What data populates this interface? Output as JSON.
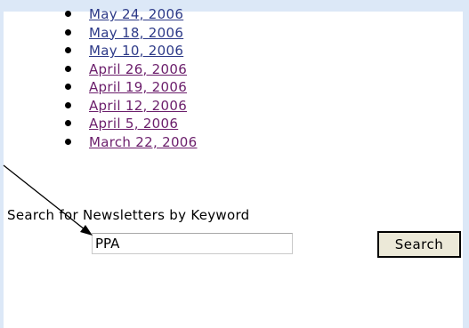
{
  "newsletter_dates": [
    {
      "label": "May 24, 2006",
      "visited": false
    },
    {
      "label": "May 18, 2006",
      "visited": false
    },
    {
      "label": "May 10, 2006",
      "visited": false
    },
    {
      "label": "April 26, 2006",
      "visited": true
    },
    {
      "label": "April 19, 2006",
      "visited": true
    },
    {
      "label": "April 12, 2006",
      "visited": true
    },
    {
      "label": "April 5, 2006",
      "visited": true
    },
    {
      "label": "March 22, 2006",
      "visited": true
    }
  ],
  "search": {
    "label": "Search for Newsletters by Keyword",
    "value": "PPA",
    "button_label": "Search"
  },
  "colors": {
    "link": "#2d3a88",
    "visited_link": "#6b1e6b",
    "frame": "#dce8f7",
    "button_face": "#ece9d8"
  },
  "icons": {
    "arrow": "annotation-arrow-icon"
  }
}
